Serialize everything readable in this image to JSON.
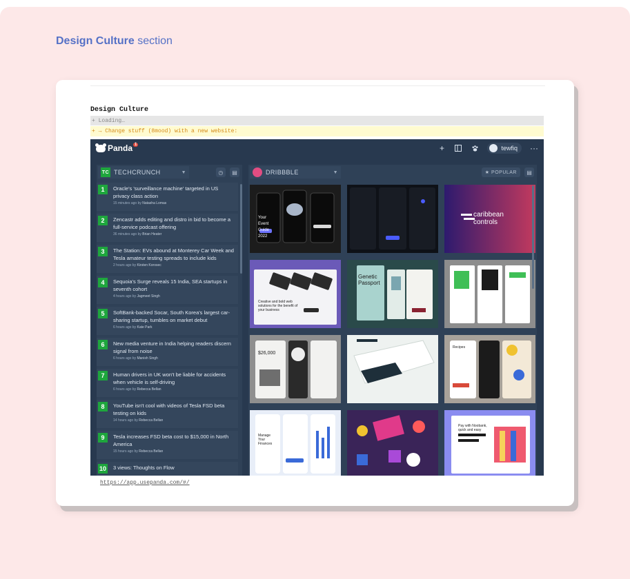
{
  "page": {
    "heading_bold": "Design Culture",
    "heading_rest": " section"
  },
  "doc": {
    "title": "Design Culture",
    "loading_text": "+ Loading…",
    "notice_text": "+ → Change stuff (8mood) with a new website:",
    "url": "https://app.usepanda.com/#/"
  },
  "app": {
    "brand": "Panda",
    "brand_badge": "1",
    "username": "tewfiq",
    "header_icons": [
      "plus-icon",
      "layout-icon",
      "paw-icon",
      "avatar-icon",
      "more-icon"
    ]
  },
  "techcrunch": {
    "source": "TECHCRUNCH",
    "logo_text": "TC",
    "items": [
      {
        "num": "1",
        "title": "Oracle's 'surveillance machine' targeted in US privacy class action",
        "time": "15 minutes ago by",
        "author": "Natasha Lomas"
      },
      {
        "num": "2",
        "title": "Zencastr adds editing and distro in bid to become a full-service podcast offering",
        "time": "36 minutes ago by",
        "author": "Brian Heater"
      },
      {
        "num": "3",
        "title": "The Station: EVs abound at Monterey Car Week and Tesla amateur testing spreads to include kids",
        "time": "2 hours ago by",
        "author": "Kirsten Korosec"
      },
      {
        "num": "4",
        "title": "Sequoia's Surge reveals 15 India, SEA startups in seventh cohort",
        "time": "4 hours ago by",
        "author": "Jagmeet Singh"
      },
      {
        "num": "5",
        "title": "SoftBank-backed Socar, South Korea's largest car-sharing startup, tumbles on market debut",
        "time": "6 hours ago by",
        "author": "Kate Park"
      },
      {
        "num": "6",
        "title": "New media venture in India helping readers discern signal from noise",
        "time": "6 hours ago by",
        "author": "Manish Singh"
      },
      {
        "num": "7",
        "title": "Human drivers in UK won't be liable for accidents when vehicle is self-driving",
        "time": "6 hours ago by",
        "author": "Rebecca Bellan"
      },
      {
        "num": "8",
        "title": "YouTube isn't cool with videos of Tesla FSD beta testing on kids",
        "time": "14 hours ago by",
        "author": "Rebecca Bellan"
      },
      {
        "num": "9",
        "title": "Tesla increases FSD beta cost to $15,000 in North America",
        "time": "15 hours ago by",
        "author": "Rebecca Bellan"
      },
      {
        "num": "10",
        "title": "3 views: Thoughts on Flow",
        "time": "",
        "author": ""
      }
    ]
  },
  "dribbble": {
    "source": "DRIBBBLE",
    "popular_label": "POPULAR",
    "shots": [
      {
        "name": "shot-wallet-app",
        "text": "Your Event Guide 2022",
        "bg": "#1c1c1c"
      },
      {
        "name": "shot-dark-dashboard",
        "text": "",
        "bg": "#0e1117"
      },
      {
        "name": "shot-caribbean-controls",
        "text": "caribbean controls",
        "bg": "#3b1f7a"
      },
      {
        "name": "shot-phones-landing",
        "text": "Creative and bold web solutions for the benefit of your business",
        "bg": "#6b5ab8"
      },
      {
        "name": "shot-genetic-passport",
        "text": "Genetic Passport",
        "bg": "#2a4a4a"
      },
      {
        "name": "shot-green-ecommerce",
        "text": "",
        "bg": "#8d8d8d"
      },
      {
        "name": "shot-finance-cards",
        "text": "$26,000",
        "bg": "#8f8f8f"
      },
      {
        "name": "shot-isometric-web",
        "text": "",
        "bg": "#eef2f0"
      },
      {
        "name": "shot-delivery-app",
        "text": "Recipes",
        "bg": "#a8a29a"
      },
      {
        "name": "shot-budget-app",
        "text": "Manage Your Finances",
        "bg": "#e8eef8"
      },
      {
        "name": "shot-3d-icons",
        "text": "",
        "bg": "#3a2458"
      },
      {
        "name": "shot-pay-with-noobank",
        "text": "Pay with Noobank, quick and easy",
        "bg": "#8a8cf0"
      }
    ]
  }
}
